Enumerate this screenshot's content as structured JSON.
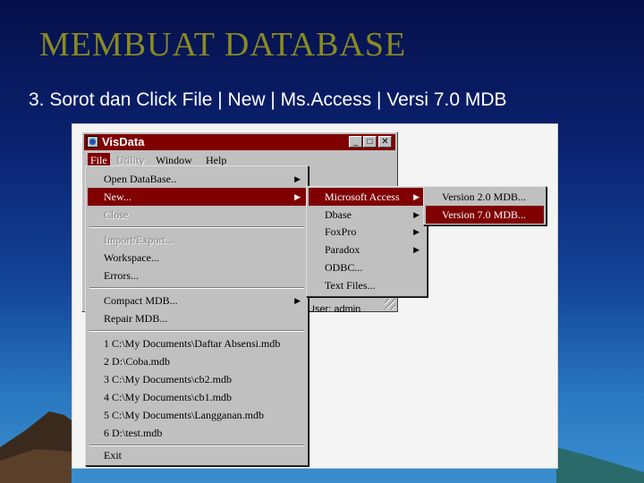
{
  "slide": {
    "title": "MEMBUAT  DATABASE",
    "subtitle": "3. Sorot dan Click File  |  New  |  Ms.Access  | Versi 7.0 MDB"
  },
  "window": {
    "title": "VisData",
    "menubar": [
      "File",
      "Utility",
      "Window",
      "Help"
    ],
    "status": "User: admin"
  },
  "file_menu": {
    "items": [
      {
        "label": "Open DataBase..",
        "submenu": true,
        "state": "normal"
      },
      {
        "label": "New...",
        "submenu": true,
        "state": "highlighted"
      },
      {
        "label": "Close",
        "submenu": false,
        "state": "disabled"
      },
      {
        "label": "Import/Export...",
        "submenu": false,
        "state": "disabled"
      },
      {
        "label": "Workspace...",
        "submenu": false,
        "state": "normal"
      },
      {
        "label": "Errors...",
        "submenu": false,
        "state": "normal"
      },
      {
        "label": "Compact MDB...",
        "submenu": true,
        "state": "normal"
      },
      {
        "label": "Repair MDB...",
        "submenu": false,
        "state": "normal"
      },
      {
        "label": "1 C:\\My Documents\\Daftar Absensi.mdb",
        "submenu": false,
        "state": "normal"
      },
      {
        "label": "2 D:\\Coba.mdb",
        "submenu": false,
        "state": "normal"
      },
      {
        "label": "3 C:\\My Documents\\cb2.mdb",
        "submenu": false,
        "state": "normal"
      },
      {
        "label": "4 C:\\My Documents\\cb1.mdb",
        "submenu": false,
        "state": "normal"
      },
      {
        "label": "5 C:\\My Documents\\Langganan.mdb",
        "submenu": false,
        "state": "normal"
      },
      {
        "label": "6 D:\\test.mdb",
        "submenu": false,
        "state": "normal"
      },
      {
        "label": "Exit",
        "submenu": false,
        "state": "normal"
      }
    ]
  },
  "new_menu": {
    "items": [
      {
        "label": "Microsoft Access",
        "submenu": true,
        "state": "highlighted"
      },
      {
        "label": "Dbase",
        "submenu": true,
        "state": "normal"
      },
      {
        "label": "FoxPro",
        "submenu": true,
        "state": "normal"
      },
      {
        "label": "Paradox",
        "submenu": true,
        "state": "normal"
      },
      {
        "label": "ODBC...",
        "submenu": false,
        "state": "normal"
      },
      {
        "label": "Text Files...",
        "submenu": false,
        "state": "normal"
      }
    ]
  },
  "access_menu": {
    "items": [
      {
        "label": "Version 2.0 MDB...",
        "state": "normal"
      },
      {
        "label": "Version 7.0 MDB...",
        "state": "highlighted"
      }
    ]
  },
  "colors": {
    "highlight": "#800000",
    "menu_face": "#c0c0c0",
    "title_text": "#8a8a22"
  }
}
